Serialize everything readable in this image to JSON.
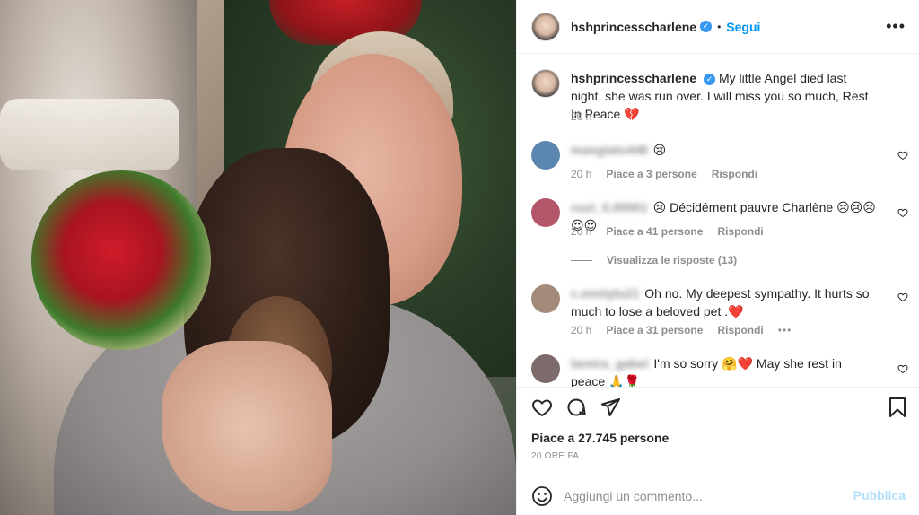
{
  "post": {
    "username": "hshprincesscharlene",
    "verified_glyph": "✓",
    "follow_label": "Segui",
    "dot": "•",
    "more_glyph": "•••",
    "caption": "My little Angel died last night, she was run over. I will miss you so much, Rest In Peace 💔",
    "caption_time": "20 h"
  },
  "comments": [
    {
      "user": "mangiato448",
      "text": "😢",
      "time": "20 h",
      "likes": "Piace a 3 persone",
      "reply": "Rispondi",
      "avatar_color": "#5a86b0"
    },
    {
      "user": "cuzi_0.00001",
      "text": "😢 Décidément pauvre Charlène 😢😢😢😍😍",
      "time": "20 h",
      "likes": "Piace a 41 persone",
      "reply": "Rispondi",
      "avatar_color": "#b4566a"
    },
    {
      "user": "c.mmlylu21",
      "text": "Oh no. My deepest sympathy. It hurts so much to lose a beloved pet .❤️",
      "time": "20 h",
      "likes": "Piace a 31 persone",
      "reply": "Rispondi",
      "avatar_color": "#a38a7a"
    },
    {
      "user": "lareira_gabel",
      "text": "I'm so sorry 🤗❤️ May she rest in peace 🙏🌹",
      "avatar_color": "#7d6a6a"
    }
  ],
  "view_replies": "Visualizza le risposte (13)",
  "comment_more": "•••",
  "likes_count": "Piace a 27.745 persone",
  "posted_ago": "20 ORE FA",
  "add_comment": {
    "placeholder": "Aggiungi un commento...",
    "publish_label": "Pubblica"
  },
  "colors": {
    "accent": "#0095f6",
    "publish_disabled": "#b2dffc",
    "muted": "#8e8e8e"
  }
}
